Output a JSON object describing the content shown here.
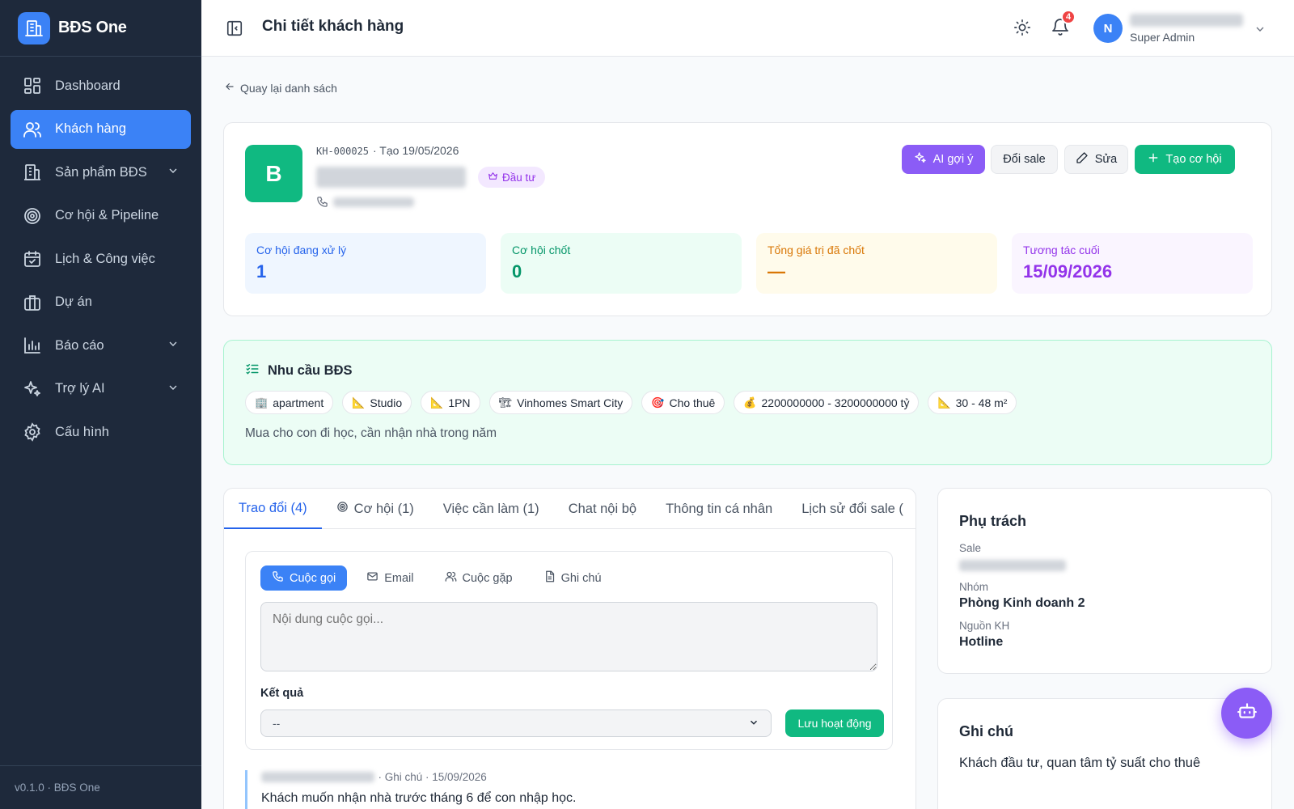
{
  "brand": {
    "name": "BĐS One"
  },
  "sidebar": {
    "items": [
      {
        "label": "Dashboard",
        "icon": "dashboard-icon"
      },
      {
        "label": "Khách hàng",
        "icon": "users-icon",
        "active": true
      },
      {
        "label": "Sản phẩm BĐS",
        "icon": "building-icon",
        "has_children": true
      },
      {
        "label": "Cơ hội & Pipeline",
        "icon": "target-icon"
      },
      {
        "label": "Lịch & Công việc",
        "icon": "calendar-icon"
      },
      {
        "label": "Dự án",
        "icon": "briefcase-icon"
      },
      {
        "label": "Báo cáo",
        "icon": "bar-chart-icon",
        "has_children": true
      },
      {
        "label": "Trợ lý AI",
        "icon": "sparkles-icon",
        "has_children": true
      },
      {
        "label": "Cấu hình",
        "icon": "gear-icon"
      }
    ],
    "footer": "v0.1.0 · BĐS One"
  },
  "header": {
    "title": "Chi tiết khách hàng",
    "notification_count": "4",
    "user": {
      "initial": "N",
      "role": "Super Admin"
    }
  },
  "back_link": "Quay lại danh sách",
  "customer": {
    "code": "KH-000025",
    "created": "· Tạo 19/05/2026",
    "avatar_initial": "B",
    "tag": "Đầu tư",
    "actions": {
      "ai": "AI gợi ý",
      "change_sale": "Đổi sale",
      "edit": "Sửa",
      "create_opportunity": "Tạo cơ hội"
    }
  },
  "stats": [
    {
      "label": "Cơ hội đang xử lý",
      "value": "1"
    },
    {
      "label": "Cơ hội chốt",
      "value": "0"
    },
    {
      "label": "Tổng giá trị đã chốt",
      "value": "—"
    },
    {
      "label": "Tương tác cuối",
      "value": "15/09/2026"
    }
  ],
  "needs": {
    "title": "Nhu cầu BĐS",
    "chips": [
      {
        "emoji": "🏢",
        "text": "apartment"
      },
      {
        "emoji": "📐",
        "text": "Studio"
      },
      {
        "emoji": "📐",
        "text": "1PN"
      },
      {
        "emoji": "🏗",
        "text": "Vinhomes Smart City"
      },
      {
        "emoji": "🎯",
        "text": "Cho thuê"
      },
      {
        "emoji": "💰",
        "text": "2200000000 - 3200000000 tỷ"
      },
      {
        "emoji": "📐",
        "text": "30 - 48 m²"
      }
    ],
    "note": "Mua cho con đi học, cần nhận nhà trong năm"
  },
  "tabs": [
    {
      "label": "Trao đổi (4)",
      "active": true
    },
    {
      "label": "Cơ hội (1)",
      "icon": "target-icon"
    },
    {
      "label": "Việc cần làm (1)"
    },
    {
      "label": "Chat nội bộ"
    },
    {
      "label": "Thông tin cá nhân"
    },
    {
      "label": "Lịch sử đổi sale ("
    }
  ],
  "activity": {
    "types": [
      {
        "label": "Cuộc gọi",
        "active": true
      },
      {
        "label": "Email"
      },
      {
        "label": "Cuộc gặp"
      },
      {
        "label": "Ghi chú"
      }
    ],
    "placeholder": "Nội dung cuộc gọi...",
    "result_label": "Kết quả",
    "result_value": "--",
    "save_label": "Lưu hoạt động"
  },
  "log": {
    "meta": "· Ghi chú · 15/09/2026",
    "text": "Khách muốn nhận nhà trước tháng 6 để con nhập học."
  },
  "assignment": {
    "title": "Phụ trách",
    "sale_label": "Sale",
    "group_label": "Nhóm",
    "group_value": "Phòng Kinh doanh 2",
    "source_label": "Nguồn KH",
    "source_value": "Hotline"
  },
  "notes": {
    "title": "Ghi chú",
    "text": "Khách đầu tư, quan tâm tỷ suất cho thuê"
  },
  "colors": {
    "primary": "#3b82f6",
    "success": "#10b981",
    "ai": "#8b5cf6",
    "sidebar": "#1e293b"
  }
}
